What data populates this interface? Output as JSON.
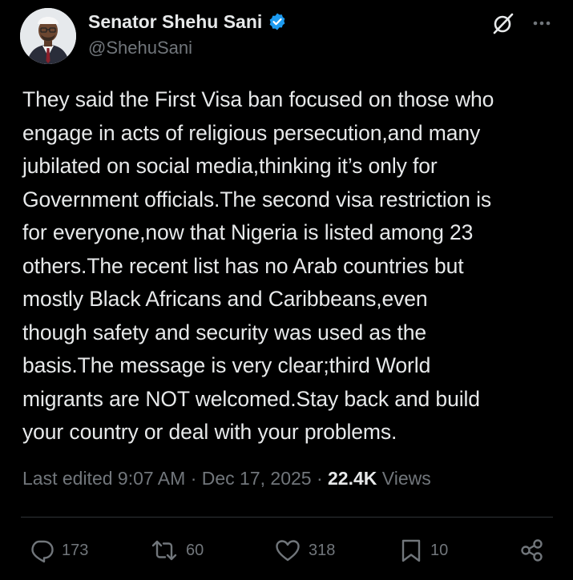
{
  "author": {
    "display_name": "Senator Shehu Sani",
    "handle": "@ShehuSani",
    "verified": true
  },
  "tweet": {
    "text": "They said the First Visa ban focused on those who\nengage in acts of religious persecution,and many\njubilated on social media,thinking it’s only for\nGovernment officials.The second visa restriction is\nfor everyone,now that Nigeria is listed among 23\nothers.The recent list has no Arab countries but\nmostly Black Africans and Caribbeans,even\nthough safety and security was used as the\nbasis.The message is very clear;third World\nmigrants are NOT welcomed.Stay back and build\nyour country or deal with your problems."
  },
  "meta": {
    "edited_label": "Last edited 9:07 AM · Dec 17, 2025 · ",
    "views_count": "22.4K",
    "views_label": " Views"
  },
  "actions": {
    "replies": "173",
    "reposts": "60",
    "likes": "318",
    "bookmarks": "10"
  },
  "icons": {
    "header": [
      "grok-icon",
      "more-icon"
    ],
    "actions": [
      "reply-icon",
      "repost-icon",
      "like-icon",
      "bookmark-icon",
      "share-icon"
    ]
  },
  "colors": {
    "background": "#000000",
    "text": "#e7e9ea",
    "secondary": "#71767b",
    "verified": "#1d9bf0",
    "divider": "#2f3336"
  }
}
